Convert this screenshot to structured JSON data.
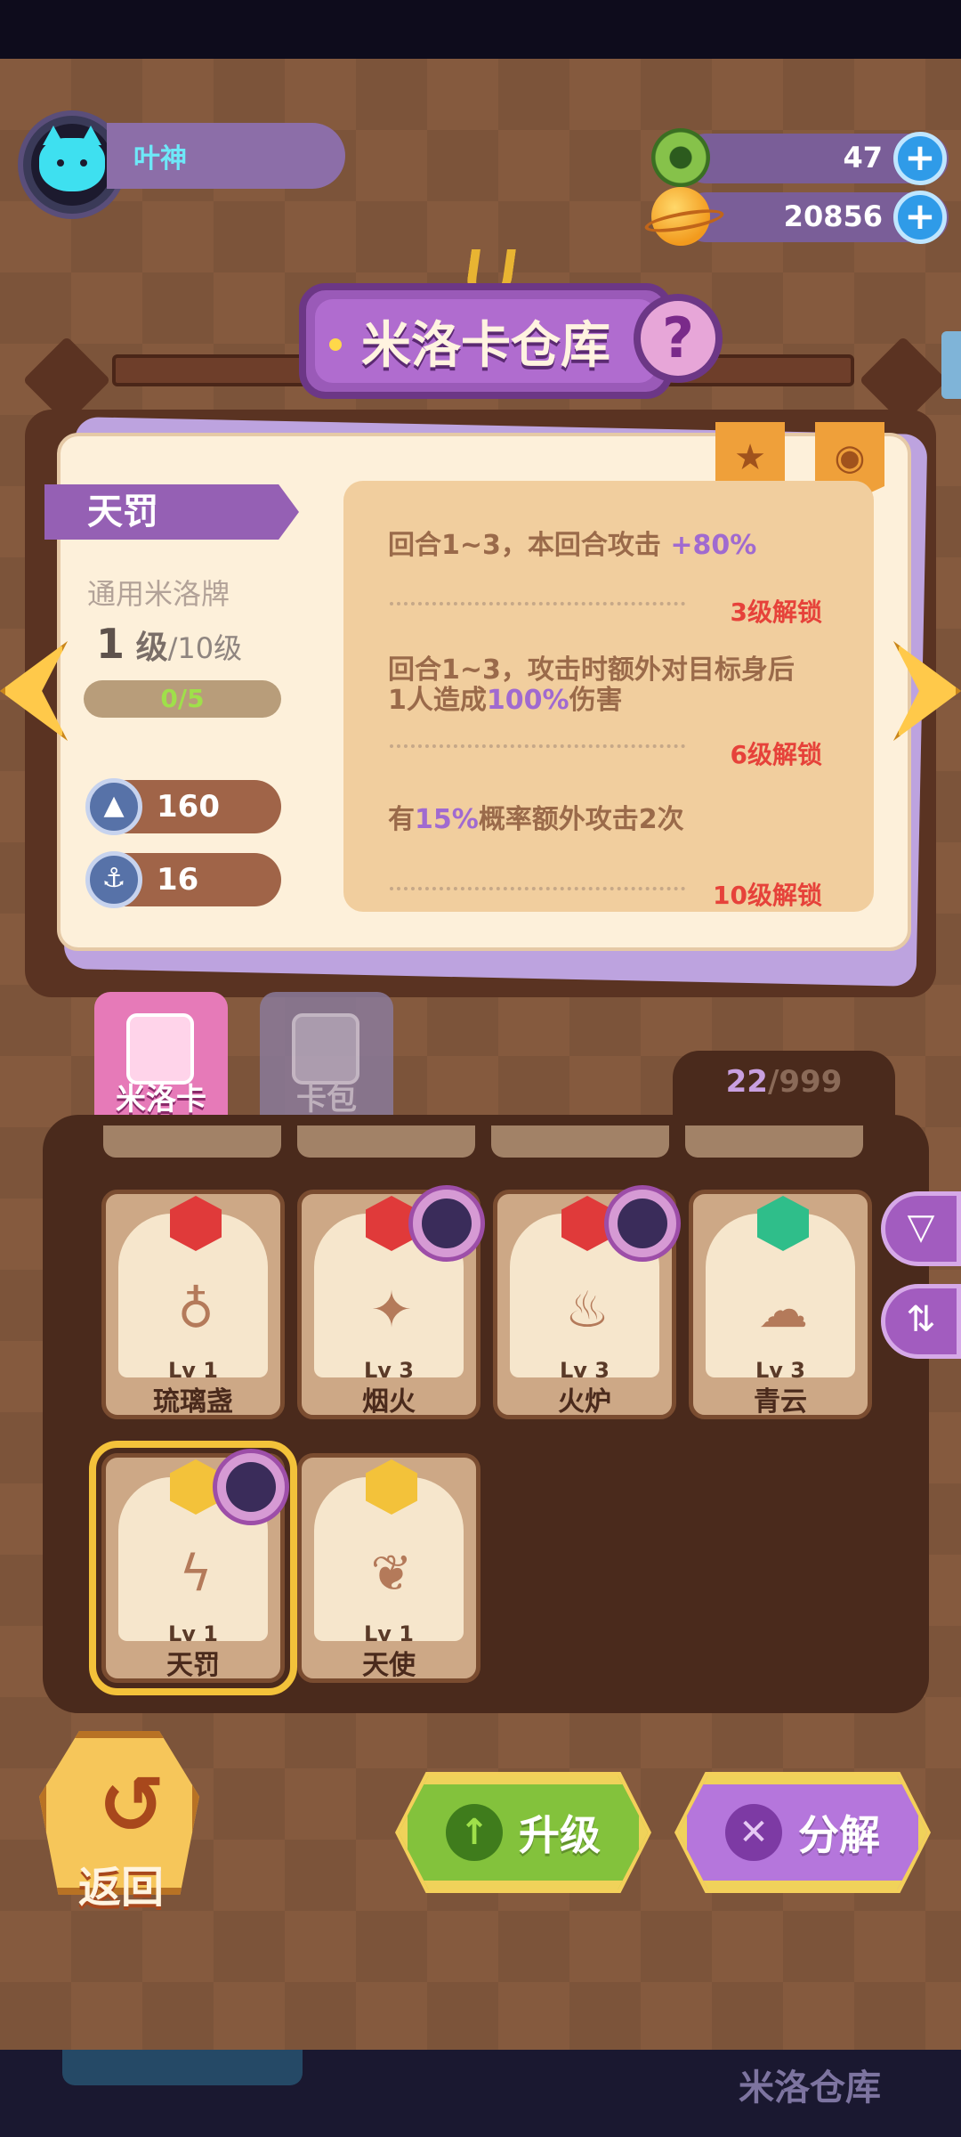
{
  "player": {
    "name": "叶神"
  },
  "resources": [
    {
      "name": "donut-currency",
      "value": "47",
      "icon": "donut-icon"
    },
    {
      "name": "planet-currency",
      "value": "20856",
      "icon": "planet-icon"
    }
  ],
  "title": "米洛卡仓库",
  "detail": {
    "card_name": "天罚",
    "type_label": "通用米洛牌",
    "level_current": "1",
    "level_unit": "级",
    "level_max": "/10级",
    "xp_text": "0/5",
    "xp_fraction": 0.0,
    "stat_attack": "160",
    "stat_defense": "16",
    "skills": [
      {
        "pre": "回合1~3，本回合攻击 ",
        "highlight": "+80%",
        "post": "",
        "unlock": "3级解锁"
      },
      {
        "pre": "回合1~3，攻击时额外对目标身后1人造成",
        "highlight": "100%",
        "post": "伤害",
        "unlock": "6级解锁"
      },
      {
        "pre": "有",
        "highlight": "15%",
        "post": "概率额外攻击2次",
        "unlock": "10级解锁"
      }
    ]
  },
  "tabs": [
    {
      "label": "米洛卡",
      "active": true
    },
    {
      "label": "卡包",
      "active": false
    }
  ],
  "inventory": {
    "count_current": "22",
    "count_max": "/999"
  },
  "cards": [
    {
      "name": "琉璃盏",
      "level": "Lv 1",
      "gem": "red",
      "icon": "goblet-icon",
      "has_avatar": false
    },
    {
      "name": "烟火",
      "level": "Lv 3",
      "gem": "red",
      "icon": "firework-icon",
      "has_avatar": true
    },
    {
      "name": "火炉",
      "level": "Lv 3",
      "gem": "red",
      "icon": "brazier-icon",
      "has_avatar": true
    },
    {
      "name": "青云",
      "level": "Lv 3",
      "gem": "green",
      "icon": "cloud-icon",
      "has_avatar": false
    },
    {
      "name": "天罚",
      "level": "Lv 1",
      "gem": "gold",
      "icon": "lightning-icon",
      "has_avatar": true,
      "selected": true
    },
    {
      "name": "天使",
      "level": "Lv 1",
      "gem": "gold",
      "icon": "angel-wings-icon",
      "has_avatar": false
    }
  ],
  "buttons": {
    "back": "返回",
    "upgrade": "升级",
    "decompose": "分解"
  },
  "bottom_bar": {
    "label": "米洛仓库"
  }
}
